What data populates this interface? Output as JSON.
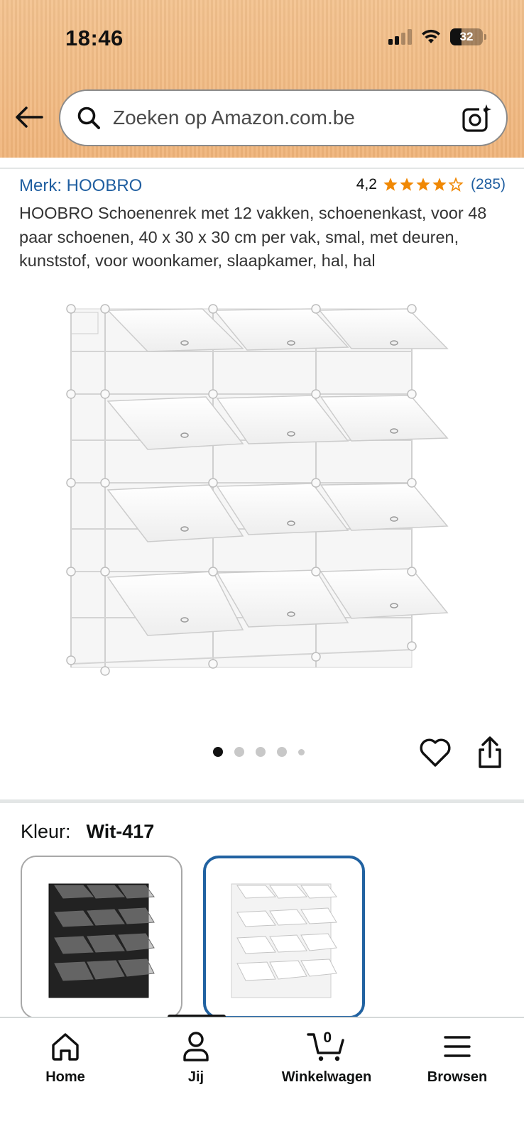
{
  "status_bar": {
    "time": "18:46",
    "battery": "32"
  },
  "search": {
    "placeholder": "Zoeken op Amazon.com.be"
  },
  "product": {
    "brand": "Merk: HOOBRO",
    "rating_value": "4,2",
    "rating_stars": 4.2,
    "rating_count": "(285)",
    "title": "HOOBRO Schoenenrek met 12 vakken, schoenenkast, voor 48 paar schoenen, 40 x 30 x 30 cm per vak, smal, met deuren, kunststof, voor woonkamer, slaapkamer, hal, hal"
  },
  "gallery": {
    "image_count": 5,
    "active_index": 0
  },
  "variant": {
    "label": "Kleur:",
    "selected": "Wit-417",
    "options": [
      "Zwart",
      "Wit-417"
    ]
  },
  "nav": {
    "items": [
      {
        "label": "Home",
        "icon": "home-icon"
      },
      {
        "label": "Jij",
        "icon": "person-icon"
      },
      {
        "label": "Winkelwagen",
        "icon": "cart-icon",
        "count": "0"
      },
      {
        "label": "Browsen",
        "icon": "menu-icon"
      }
    ],
    "active_index": 1
  },
  "colors": {
    "header": "#f0b47a",
    "link": "#1f5ea0",
    "star": "#f08804",
    "selected_border": "#2162a1"
  }
}
